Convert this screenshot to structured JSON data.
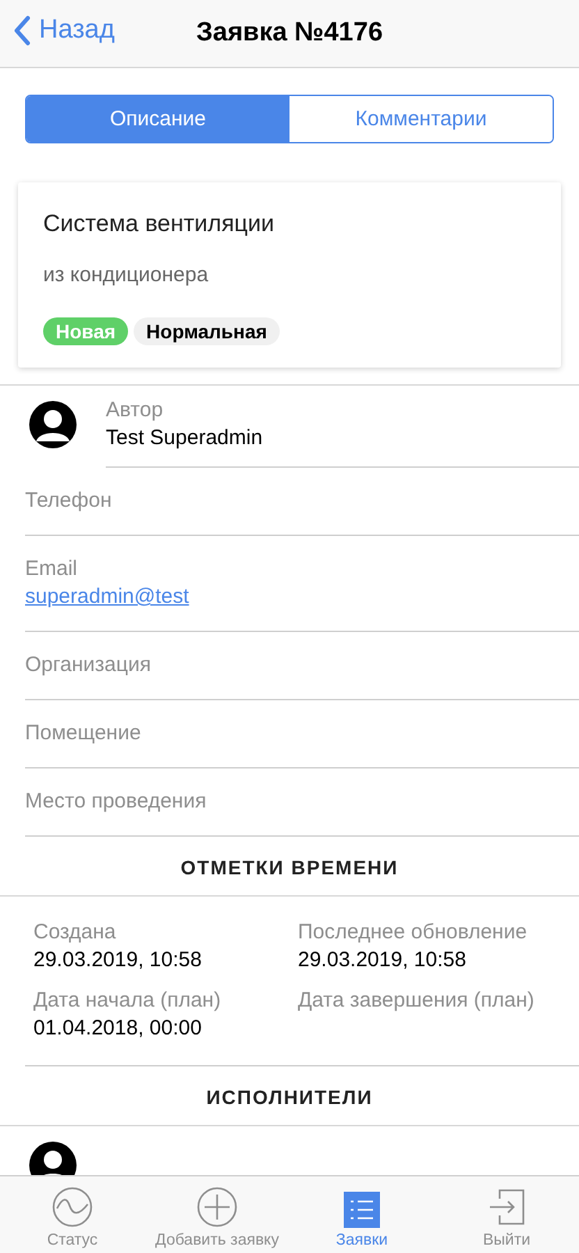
{
  "nav": {
    "back": "Назад",
    "title": "Заявка №4176"
  },
  "tabs": [
    {
      "label": "Описание",
      "selected": true
    },
    {
      "label": "Комментарии",
      "selected": false
    }
  ],
  "card": {
    "title": "Система вентиляции",
    "description": "из кондиционера",
    "tags": [
      {
        "label": "Новая",
        "color": "#5fd068"
      },
      {
        "label": "Нормальная",
        "color": "#f0f0f0"
      }
    ]
  },
  "author": {
    "label": "Автор",
    "value": "Test Superadmin"
  },
  "fields": [
    {
      "label": "Телефон"
    },
    {
      "label": "Email",
      "value": "superadmin@test",
      "kind": "link"
    },
    {
      "label": "Организация"
    },
    {
      "label": "Помещение"
    },
    {
      "label": "Место проведения"
    }
  ],
  "timestamps": {
    "title": "ОТМЕТКИ ВРЕМЕНИ",
    "items": [
      {
        "label": "Создана",
        "value": "29.03.2019, 10:58"
      },
      {
        "label": "Последнее обновление",
        "value": "29.03.2019, 10:58"
      },
      {
        "label": "Дата начала (план)",
        "value": "01.04.2018, 00:00"
      },
      {
        "label": "Дата завершения (план)"
      }
    ]
  },
  "performers": {
    "title": "ИСПОЛНИТЕЛИ"
  },
  "tabbar": [
    {
      "label": "Статус",
      "kind": "status",
      "selected": false
    },
    {
      "label": "Добавить заявку",
      "kind": "add",
      "selected": false
    },
    {
      "label": "Заявки",
      "kind": "list",
      "selected": true
    },
    {
      "label": "Выйти",
      "kind": "exit",
      "selected": false
    }
  ]
}
